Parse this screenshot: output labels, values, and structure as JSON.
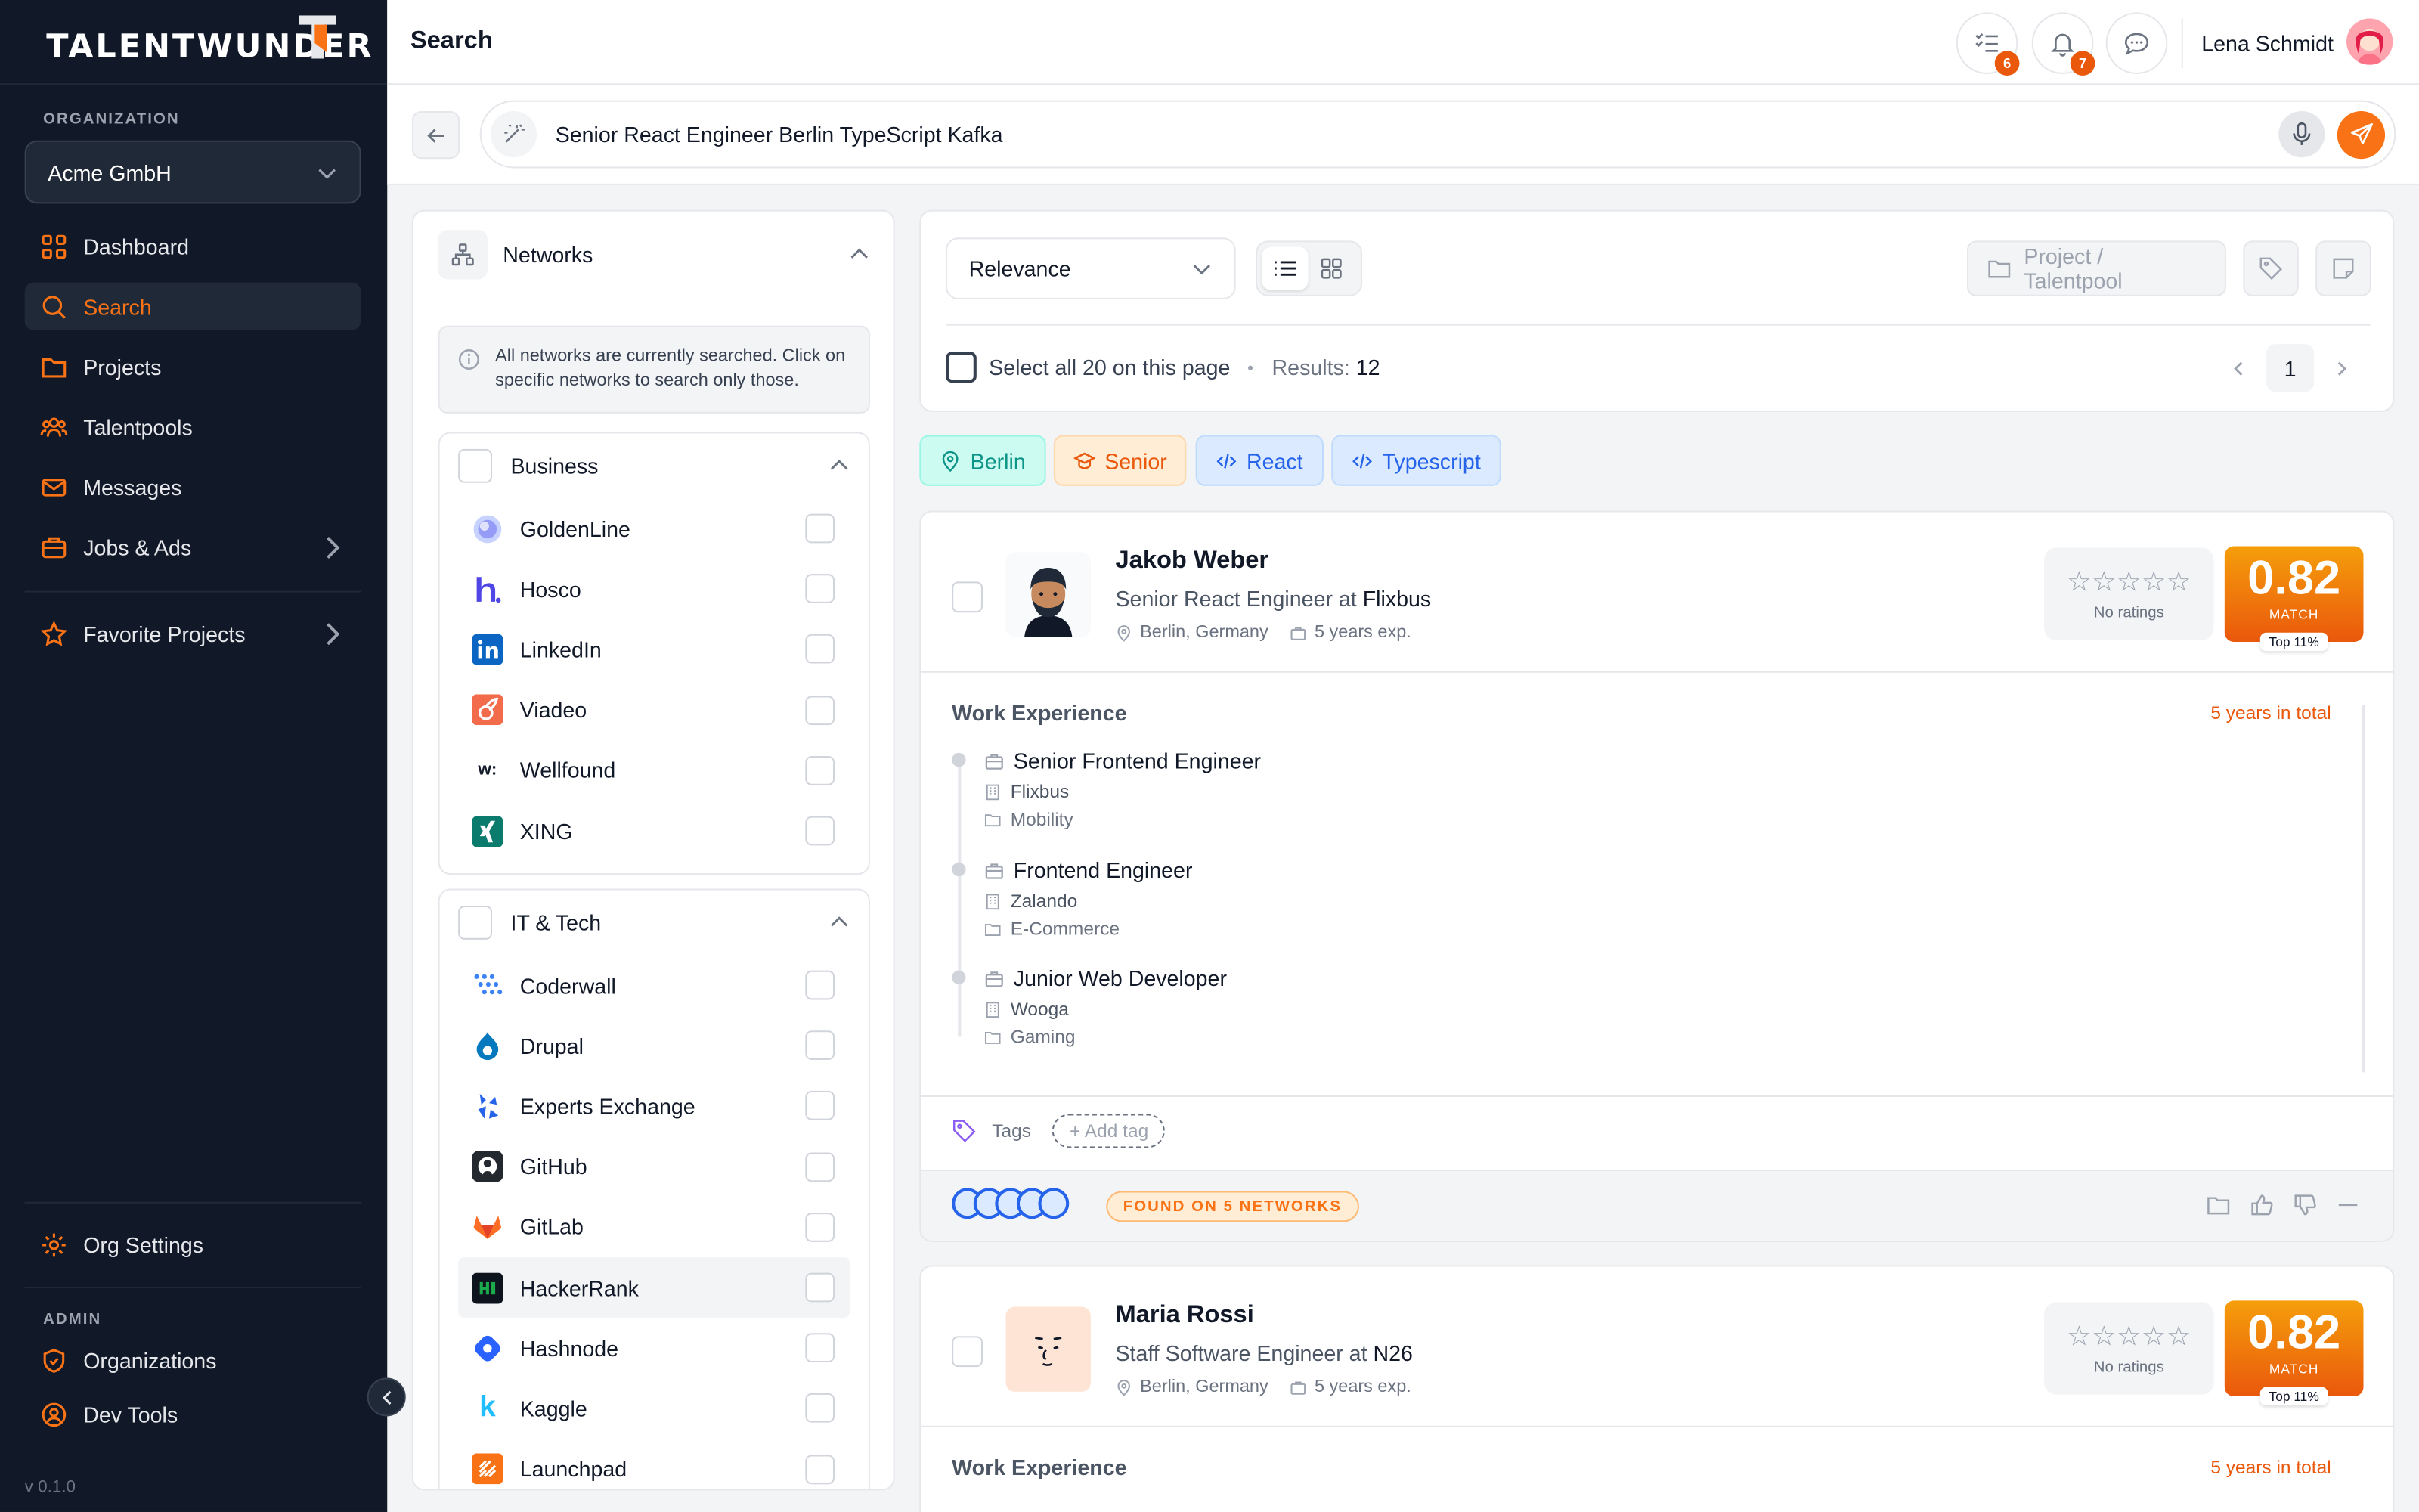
{
  "app": {
    "logo": "TALENTWUNDER",
    "version": "v 0.1.0"
  },
  "sidebar": {
    "org_label": "ORGANIZATION",
    "org_value": "Acme GmbH",
    "nav": [
      {
        "label": "Dashboard",
        "icon": "grid-icon"
      },
      {
        "label": "Search",
        "icon": "search-icon",
        "active": true
      },
      {
        "label": "Projects",
        "icon": "folder-icon"
      },
      {
        "label": "Talentpools",
        "icon": "users-icon"
      },
      {
        "label": "Messages",
        "icon": "mail-icon"
      },
      {
        "label": "Jobs & Ads",
        "icon": "briefcase-icon"
      }
    ],
    "favorite": "Favorite Projects",
    "org_settings": "Org Settings",
    "admin_label": "ADMIN",
    "admin_items": [
      {
        "label": "Organizations"
      },
      {
        "label": "Dev Tools"
      }
    ]
  },
  "header": {
    "title": "Search",
    "tasks_badge": "6",
    "notifications_badge": "7",
    "user_name": "Lena Schmidt"
  },
  "search": {
    "query": "Senior React Engineer Berlin TypeScript Kafka"
  },
  "networks": {
    "title": "Networks",
    "info": "All networks are currently searched. Click on specific networks to search only those.",
    "groups": [
      {
        "title": "Business",
        "items": [
          "GoldenLine",
          "Hosco",
          "LinkedIn",
          "Viadeo",
          "Wellfound",
          "XING"
        ]
      },
      {
        "title": "IT & Tech",
        "items": [
          "Coderwall",
          "Drupal",
          "Experts Exchange",
          "GitHub",
          "GitLab",
          "HackerRank",
          "Hashnode",
          "Kaggle",
          "Launchpad"
        ]
      }
    ]
  },
  "toolbar": {
    "sort": "Relevance",
    "project_button": "Project / Talentpool",
    "select_all": "Select all 20 on this page",
    "results_label": "Results:",
    "results_count": "12",
    "page": "1"
  },
  "filters": [
    {
      "label": "Berlin",
      "icon": "pin-icon",
      "color": "#0d9488"
    },
    {
      "label": "Senior",
      "icon": "graduation-icon",
      "color": "#ea580c"
    },
    {
      "label": "React",
      "icon": "code-icon",
      "color": "#2563eb"
    },
    {
      "label": "Typescript",
      "icon": "code-icon",
      "color": "#2563eb"
    }
  ],
  "candidates": [
    {
      "name": "Jakob Weber",
      "role_prefix": "Senior React Engineer at",
      "company": "Flixbus",
      "location": "Berlin, Germany",
      "experience": "5 years exp.",
      "ratings": "No ratings",
      "score": "0.82",
      "match_label": "MATCH",
      "top": "Top 11%",
      "work_label": "Work Experience",
      "work_total": "5 years in total",
      "jobs": [
        {
          "title": "Senior Frontend Engineer",
          "company": "Flixbus",
          "industry": "Mobility"
        },
        {
          "title": "Frontend Engineer",
          "company": "Zalando",
          "industry": "E-Commerce"
        },
        {
          "title": "Junior Web Developer",
          "company": "Wooga",
          "industry": "Gaming"
        }
      ],
      "tags_label": "Tags",
      "add_tag": "+ Add tag",
      "found": "FOUND ON 5 NETWORKS"
    },
    {
      "name": "Maria Rossi",
      "role_prefix": "Staff Software Engineer at",
      "company": "N26",
      "location": "Berlin, Germany",
      "experience": "5 years exp.",
      "ratings": "No ratings",
      "score": "0.82",
      "match_label": "MATCH",
      "top": "Top 11%",
      "work_label": "Work Experience",
      "work_total": "5 years in total"
    }
  ]
}
